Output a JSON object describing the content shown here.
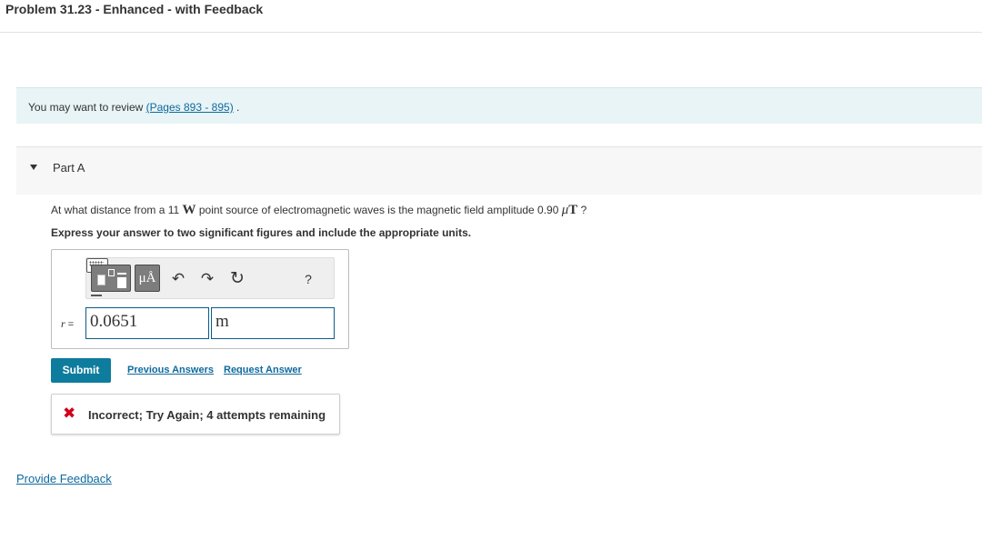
{
  "header": {
    "title": "Problem 31.23 - Enhanced - with Feedback"
  },
  "review": {
    "prefix": "You may want to review ",
    "link": "(Pages 893 - 895)",
    "suffix": " ."
  },
  "part": {
    "label": "Part A"
  },
  "question": {
    "text_1": "At what distance from a 11 ",
    "unit_w": "W",
    "text_2": " point source of electromagnetic waves is the magnetic field amplitude 0.90 ",
    "unit_mu": "μ",
    "unit_t": "T",
    "text_3": " ?",
    "instructions": "Express your answer to two significant figures and include the appropriate units."
  },
  "toolbar": {
    "units_label": "μÅ",
    "undo_icon": "↶",
    "redo_icon": "↷",
    "reset_icon": "↻",
    "help_label": "?",
    "icons": [
      "templates-icon",
      "units-icon",
      "undo-icon",
      "redo-icon",
      "reset-icon",
      "keyboard-icon",
      "help-icon"
    ]
  },
  "answer": {
    "variable": "r",
    "equals": " =",
    "value": "0.0651",
    "units": "m"
  },
  "actions": {
    "submit_label": "Submit",
    "previous_answers": "Previous Answers",
    "request_answer": "Request Answer"
  },
  "feedback": {
    "icon": "✖",
    "message": "Incorrect; Try Again; 4 attempts remaining"
  },
  "footer": {
    "provide_feedback": "Provide Feedback"
  },
  "colors": {
    "accent": "#0e7c9d",
    "link": "#0e6a9e",
    "error": "#d0021b",
    "review_bg": "#e8f4f6"
  }
}
